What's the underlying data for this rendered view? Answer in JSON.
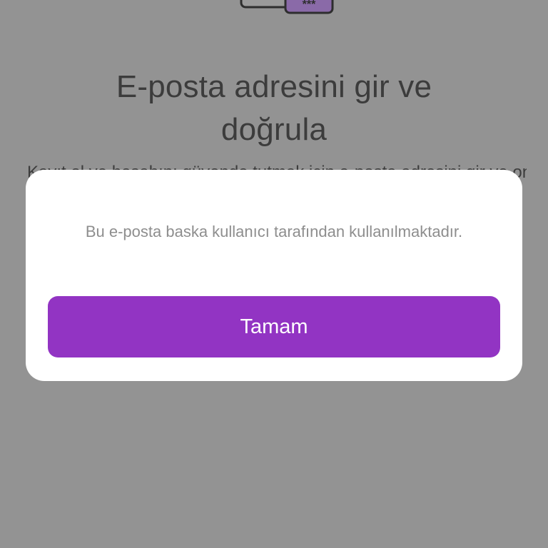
{
  "page": {
    "title": "E-posta adresini gir ve doğrula",
    "subtitle": "Kayıt ol ve hesabını güvende tutmak için e-posta adresini gir ve onayla. Şifreni unutursan"
  },
  "illustration": {
    "icon": "password-card-icon",
    "mask_text": "***",
    "accent_color": "#8a6aa8"
  },
  "dialog": {
    "message": "Bu e-posta baska kullanıcı tarafından kullanılmaktadır.",
    "button_label": "Tamam",
    "button_color": "#9234c3"
  },
  "colors": {
    "overlay": "#939393",
    "title": "#3c3c3c",
    "message": "#8e8e8e"
  }
}
